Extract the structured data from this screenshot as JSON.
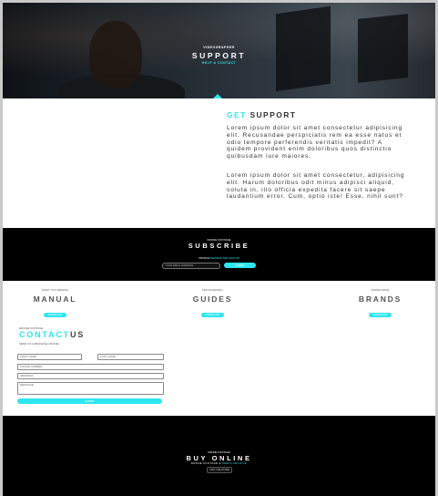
{
  "colors": {
    "accent": "#2ee6ef",
    "dark": "#000000",
    "text": "#333333"
  },
  "hero": {
    "pretitle": "VIDEOGRAPHER",
    "title": "SUPPORT",
    "subtitle": "HELP & CONTACT"
  },
  "support": {
    "heading_accent": "GET",
    "heading_rest": "SUPPORT",
    "paragraphs": [
      "Lorem ipsum dolor sit amet consectetur adipisicing elit. Recusandae perspiciatis rem ea esse natus et odio tempore perferendis veritatis impedit? A quidem provident enim doloribus quos distinctio quibusdam iure maiores.",
      "Lorem ipsum dolor sit amet consectetur, adipisicing elit. Harum doloribus odit minus adipisci aliquid, soluta in, illo officia expedita facere sit saepe laudantium error. Cum, optio iste! Esse, nihil sunt?"
    ]
  },
  "subscribe": {
    "pretitle": "DRONE FOOTAGE",
    "title": "SUBSCRIBE",
    "note_prefix": "PROFILE",
    "note_accent": "NEWSLETTER SIGN-UP",
    "input_placeholder": "YOUR EMAIL ADDRESS",
    "button_label": "SUBMIT"
  },
  "resources": [
    {
      "pretitle": "WHAT YOU SEARCH",
      "title": "MANUAL",
      "button": "DOWNLOAD"
    },
    {
      "pretitle": "PHOTOGRAPHY",
      "title": "GUIDES",
      "button": "DOWNLOAD"
    },
    {
      "pretitle": "DOWNLOADS",
      "title": "BRANDS",
      "button": "DOWNLOAD"
    }
  ],
  "contact": {
    "pretitle": "DRONE FOOTAGE",
    "title_accent": "CONTACT",
    "title_rest": "US",
    "subtitle": "SEND US A MESSAGE ONLINE",
    "fields": {
      "first_name": "FIRST NAME",
      "last_name": "LAST NAME",
      "phone": "PHONE NUMBER",
      "address": "ADDRESS",
      "message": "MESSAGE"
    },
    "send_label": "SUBMIT"
  },
  "buy": {
    "pretitle": "DRONE FOOTAGE",
    "title": "BUY ONLINE",
    "subtitle_prefix": "DRONE FOOTAGE &",
    "subtitle_accent": "MEDIA ARCHIVE",
    "button_label": "VISIT THE STORE"
  }
}
